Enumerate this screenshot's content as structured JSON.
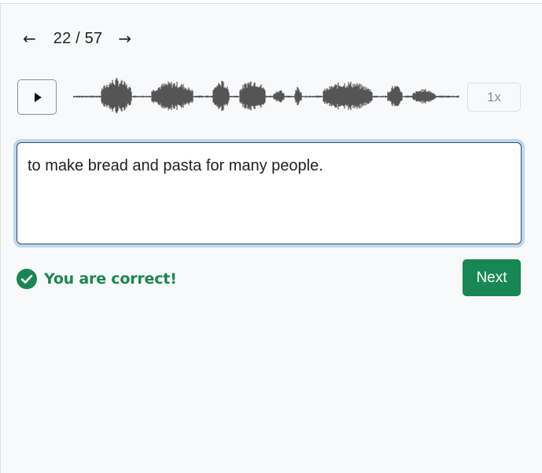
{
  "navigation": {
    "prev_icon": "arrow-left-icon",
    "prev_glyph": "←",
    "counter": "22 / 57",
    "next_icon": "arrow-right-icon",
    "next_glyph": "→"
  },
  "audio": {
    "play_icon": "play-icon",
    "speed_label": "1x"
  },
  "answer": {
    "text": "to make bread and pasta for many people."
  },
  "result": {
    "icon": "check-circle-icon",
    "message": "You are correct!"
  },
  "actions": {
    "next_label": "Next"
  },
  "colors": {
    "success": "#198754",
    "waveform": "#555555",
    "focus_ring": "#bcd8f2",
    "background": "#f8f9fb"
  }
}
